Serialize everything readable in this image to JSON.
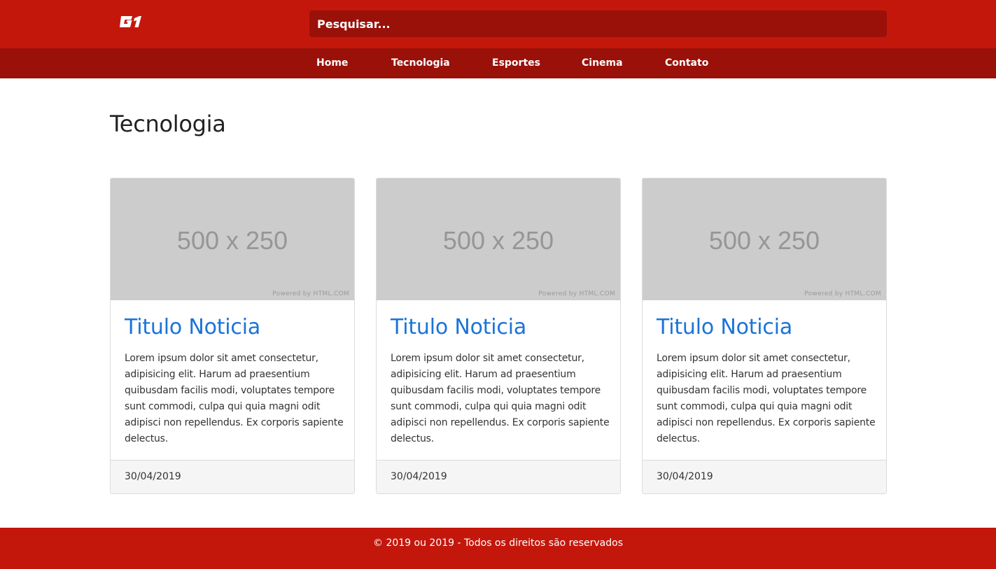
{
  "header": {
    "logo_text": "G1",
    "search": {
      "placeholder": "Pesquisar..."
    }
  },
  "nav": {
    "items": [
      {
        "label": "Home"
      },
      {
        "label": "Tecnologia"
      },
      {
        "label": "Esportes"
      },
      {
        "label": "Cinema"
      },
      {
        "label": "Contato"
      }
    ]
  },
  "main": {
    "title": "Tecnologia",
    "cards": [
      {
        "image_label": "500 x 250",
        "image_credit": "Powered by HTML.COM",
        "title": "Titulo Noticia",
        "text": "Lorem ipsum dolor sit amet consectetur, adipisicing elit. Harum ad praesentium quibusdam facilis modi, voluptates tempore sunt commodi, culpa qui quia magni odit adipisci non repellendus. Ex corporis sapiente delectus.",
        "date": "30/04/2019"
      },
      {
        "image_label": "500 x 250",
        "image_credit": "Powered by HTML.COM",
        "title": "Titulo Noticia",
        "text": "Lorem ipsum dolor sit amet consectetur, adipisicing elit. Harum ad praesentium quibusdam facilis modi, voluptates tempore sunt commodi, culpa qui quia magni odit adipisci non repellendus. Ex corporis sapiente delectus.",
        "date": "30/04/2019"
      },
      {
        "image_label": "500 x 250",
        "image_credit": "Powered by HTML.COM",
        "title": "Titulo Noticia",
        "text": "Lorem ipsum dolor sit amet consectetur, adipisicing elit. Harum ad praesentium quibusdam facilis modi, voluptates tempore sunt commodi, culpa qui quia magni odit adipisci non repellendus. Ex corporis sapiente delectus.",
        "date": "30/04/2019"
      }
    ]
  },
  "footer": {
    "text": "© 2019 ou 2019 - Todos os direitos são reservados"
  },
  "colors": {
    "brand_red": "#c4170c",
    "dark_red": "#991109",
    "link_blue": "#1a73d9",
    "placeholder_gray": "#cccccc"
  }
}
